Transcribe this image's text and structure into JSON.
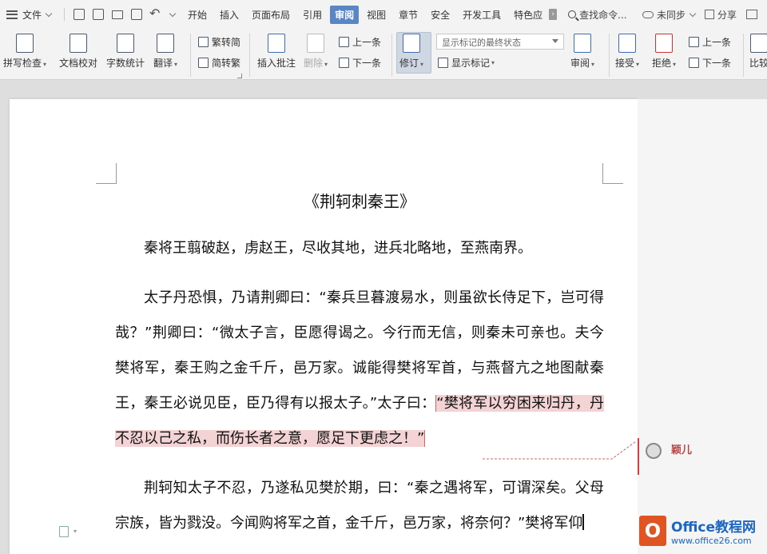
{
  "menu": {
    "file_label": "文件",
    "tabs": [
      "开始",
      "插入",
      "页面布局",
      "引用",
      "审阅",
      "视图",
      "章节",
      "安全",
      "开发工具",
      "特色应"
    ],
    "active_tab": "审阅",
    "search_label": "查找命令...",
    "sync_label": "未同步",
    "share_label": "分享"
  },
  "ribbon": {
    "spell_check": "拼写检查",
    "doc_proof": "文档校对",
    "word_count": "字数统计",
    "translate": "翻译",
    "trad_to_simp": "繁转简",
    "simp_to_trad": "简转繁",
    "insert_comment": "插入批注",
    "delete": "删除",
    "prev_top": "上一条",
    "next_top": "下一条",
    "revise": "修订",
    "display_mode": "显示标记的最终状态",
    "show_markup": "显示标记",
    "review": "审阅",
    "accept": "接受",
    "reject": "拒绝",
    "prev_right": "上一条",
    "next_right": "下一条",
    "compare": "比较"
  },
  "document": {
    "title": "《荆轲刺秦王》",
    "p1": "秦将王翦破赵，虏赵王，尽收其地，进兵北略地，至燕南界。",
    "p2_before": "太子丹恐惧，乃请荆卿曰：“秦兵旦暮渡易水，则虽欲长侍足下，岂可得哉？”荆卿曰：“微太子言，臣愿得谒之。今行而无信，则秦未可亲也。夫今樊将军，秦王购之金千斤，邑万家。诚能得樊将军首，与燕督亢之地图献秦王，秦王必说见臣，臣乃得有以报太子。”太子曰：",
    "p2_highlight": "“樊将军以穷困来归丹，丹不忍以己之私，而伤长者之意，愿足下更虑之！”",
    "p3": "荆轲知太子不忍，乃遂私见樊於期，曰：“秦之遇将军，可谓深矣。父母宗族，皆为戮没。今闻购将军之首，金千斤，邑万家，将奈何？”樊将军仰"
  },
  "comment": {
    "author": "颖儿"
  },
  "logo": {
    "mark": "O",
    "brand": "Office教程网",
    "site": "www.office26.com"
  },
  "colors": {
    "accent": "#5b86c5",
    "highlight": "#f3d3d4",
    "comment_red": "#b44"
  }
}
